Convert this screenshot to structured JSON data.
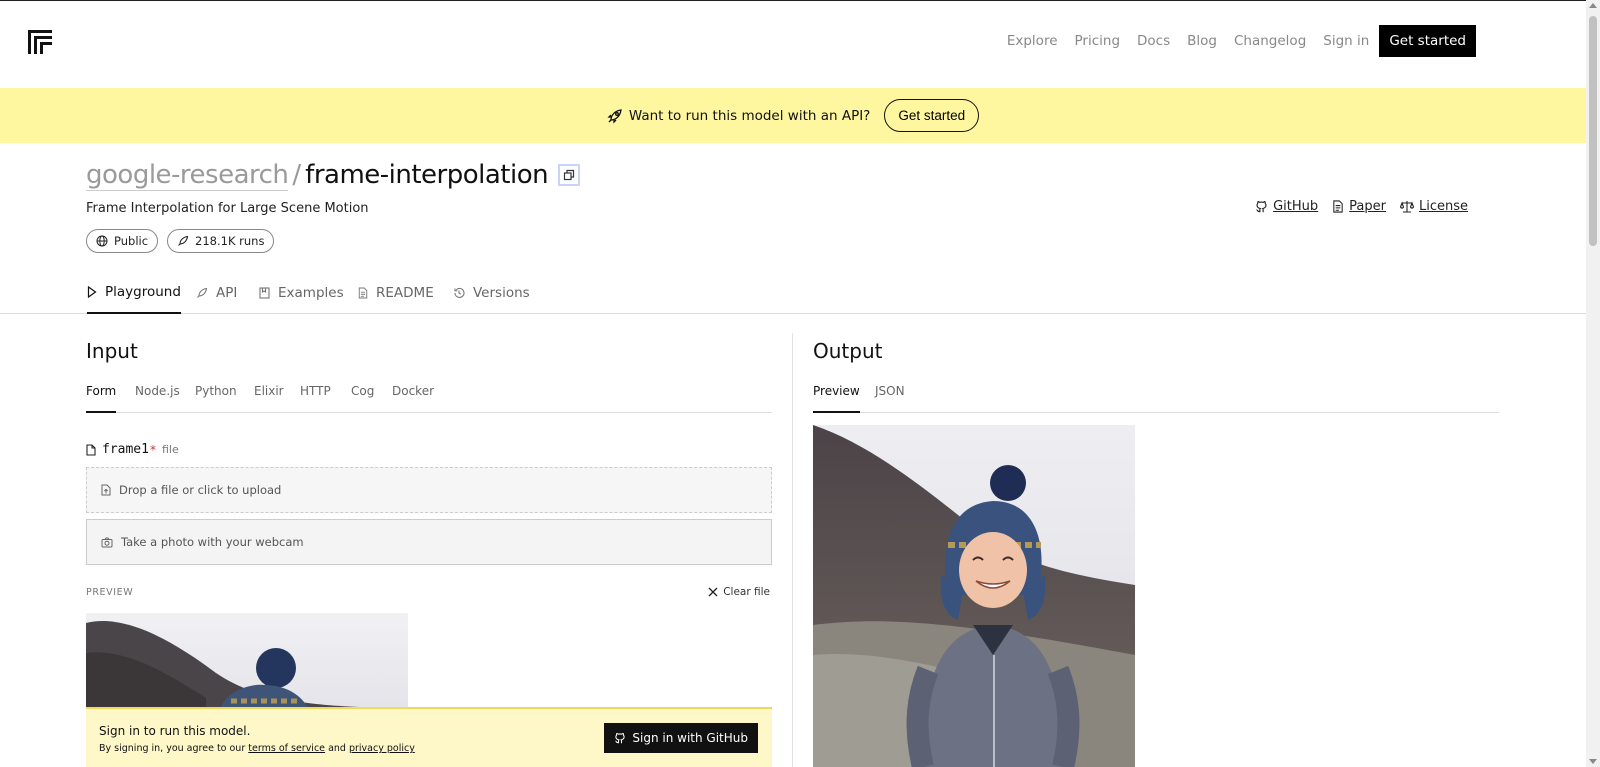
{
  "header": {
    "logo": "replicate-logo-icon",
    "nav": [
      "Explore",
      "Pricing",
      "Docs",
      "Blog",
      "Changelog",
      "Sign in"
    ],
    "cta": "Get started"
  },
  "banner": {
    "icon": "rocket-icon",
    "text": "Want to run this model with an API?",
    "button": "Get started",
    "color": "#fef7a0"
  },
  "model": {
    "owner": "google-research",
    "separator": "/",
    "name": "frame-interpolation",
    "description": "Frame Interpolation for Large Scene Motion",
    "badges": [
      {
        "icon": "globe-icon",
        "label": "Public"
      },
      {
        "icon": "rocket-icon",
        "label": "218.1K runs"
      }
    ],
    "links": [
      {
        "icon": "github-icon",
        "label": "GitHub"
      },
      {
        "icon": "document-icon",
        "label": "Paper"
      },
      {
        "icon": "scale-icon",
        "label": "License"
      }
    ]
  },
  "tabs": [
    {
      "icon": "play-icon",
      "label": "Playground",
      "active": true
    },
    {
      "icon": "rocket-icon",
      "label": "API"
    },
    {
      "icon": "bookmark-icon",
      "label": "Examples"
    },
    {
      "icon": "document-icon",
      "label": "README"
    },
    {
      "icon": "history-icon",
      "label": "Versions"
    }
  ],
  "input": {
    "title": "Input",
    "tabs": [
      "Form",
      "Node.js",
      "Python",
      "Elixir",
      "HTTP",
      "Cog",
      "Docker"
    ],
    "field": {
      "name": "frame1",
      "required_mark": "*",
      "type": "file"
    },
    "dropzone": "Drop a file or click to upload",
    "webcam": "Take a photo with your webcam",
    "preview_label": "PREVIEW",
    "clear_file": "Clear file"
  },
  "output": {
    "title": "Output",
    "tabs": [
      "Preview",
      "JSON"
    ]
  },
  "signin": {
    "title": "Sign in to run this model.",
    "terms_prefix": "By signing in, you agree to our",
    "terms_link": "terms of service",
    "and": "and",
    "privacy_link": "privacy policy",
    "button": "Sign in with GitHub",
    "bar_color": "#fef7c8"
  }
}
